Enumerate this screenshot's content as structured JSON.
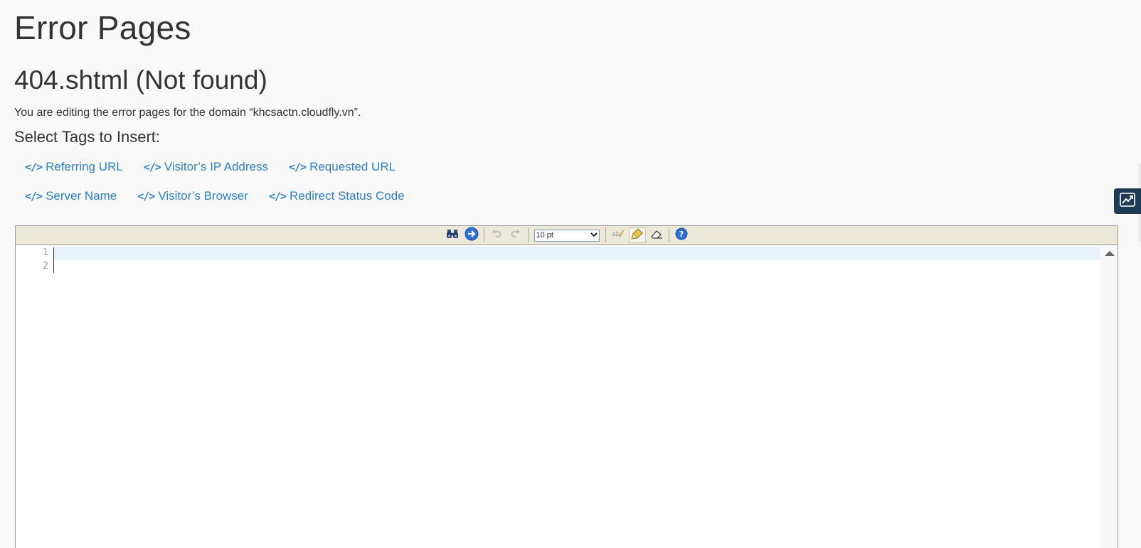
{
  "page": {
    "title": "Error Pages",
    "section_title": "404.shtml (Not found)",
    "editing_note": "You are editing the error pages for the domain “khcsactn.cloudfly.vn”.",
    "tags_heading": "Select Tags to Insert:"
  },
  "tags": {
    "row1": [
      "Referring URL",
      "Visitor’s IP Address",
      "Requested URL"
    ],
    "row2": [
      "Server Name",
      "Visitor’s Browser",
      "Redirect Status Code"
    ],
    "icon": "</>"
  },
  "editor": {
    "font_size": "10 pt",
    "line_numbers": [
      "1",
      "2"
    ],
    "toolbar_icons": [
      "search-icon",
      "go-to-line-icon",
      "undo-icon",
      "redo-icon",
      "font-size-select",
      "syntax-highlight-icon",
      "highlight-toggle-icon",
      "reset-icon",
      "help-icon"
    ]
  },
  "colors": {
    "link": "#2f80c4",
    "toolbar_bg": "#ece9d8",
    "active_line": "#e8f2fb",
    "side_tab": "#1e3a54"
  }
}
